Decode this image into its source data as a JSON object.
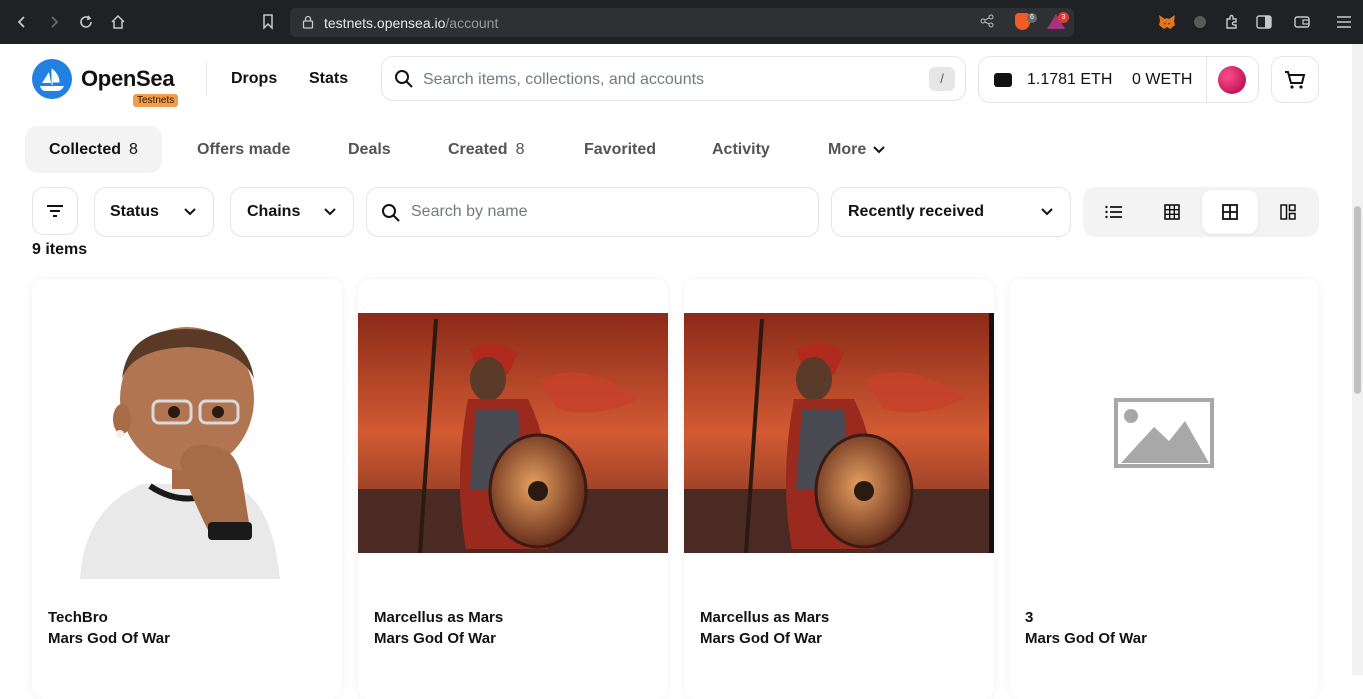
{
  "browser": {
    "url_host": "testnets.opensea.io",
    "url_path": "/account",
    "brave_shield_count": "6",
    "rewards_count": "3"
  },
  "header": {
    "logo": "OpenSea",
    "badge": "Testnets",
    "nav": [
      "Drops",
      "Stats"
    ],
    "search_placeholder": "Search items, collections, and accounts",
    "search_shortcut": "/",
    "eth_balance": "1.1781 ETH",
    "weth_balance": "0 WETH"
  },
  "tabs": [
    {
      "label": "Collected",
      "count": "8",
      "active": true
    },
    {
      "label": "Offers made",
      "count": ""
    },
    {
      "label": "Deals",
      "count": ""
    },
    {
      "label": "Created",
      "count": "8"
    },
    {
      "label": "Favorited",
      "count": ""
    },
    {
      "label": "Activity",
      "count": ""
    },
    {
      "label": "More",
      "count": ""
    }
  ],
  "filters": {
    "status": "Status",
    "chains": "Chains",
    "search_placeholder": "Search by name",
    "sort": "Recently received"
  },
  "items_count": "9 items",
  "cards": [
    {
      "title": "TechBro",
      "collection": "Mars God Of War",
      "image": "memoji-avatar"
    },
    {
      "title": "Marcellus as Mars",
      "collection": "Mars God Of War",
      "image": "roman-warrior-painting"
    },
    {
      "title": "Marcellus as Mars",
      "collection": "Mars God Of War",
      "image": "roman-warrior-painting"
    },
    {
      "title": "3",
      "collection": "Mars God Of War",
      "image": "placeholder-image-icon"
    }
  ],
  "colors": {
    "brand_blue": "#2081e2",
    "testnets_orange": "#f29c4c",
    "mars_red": "#c0392b"
  }
}
